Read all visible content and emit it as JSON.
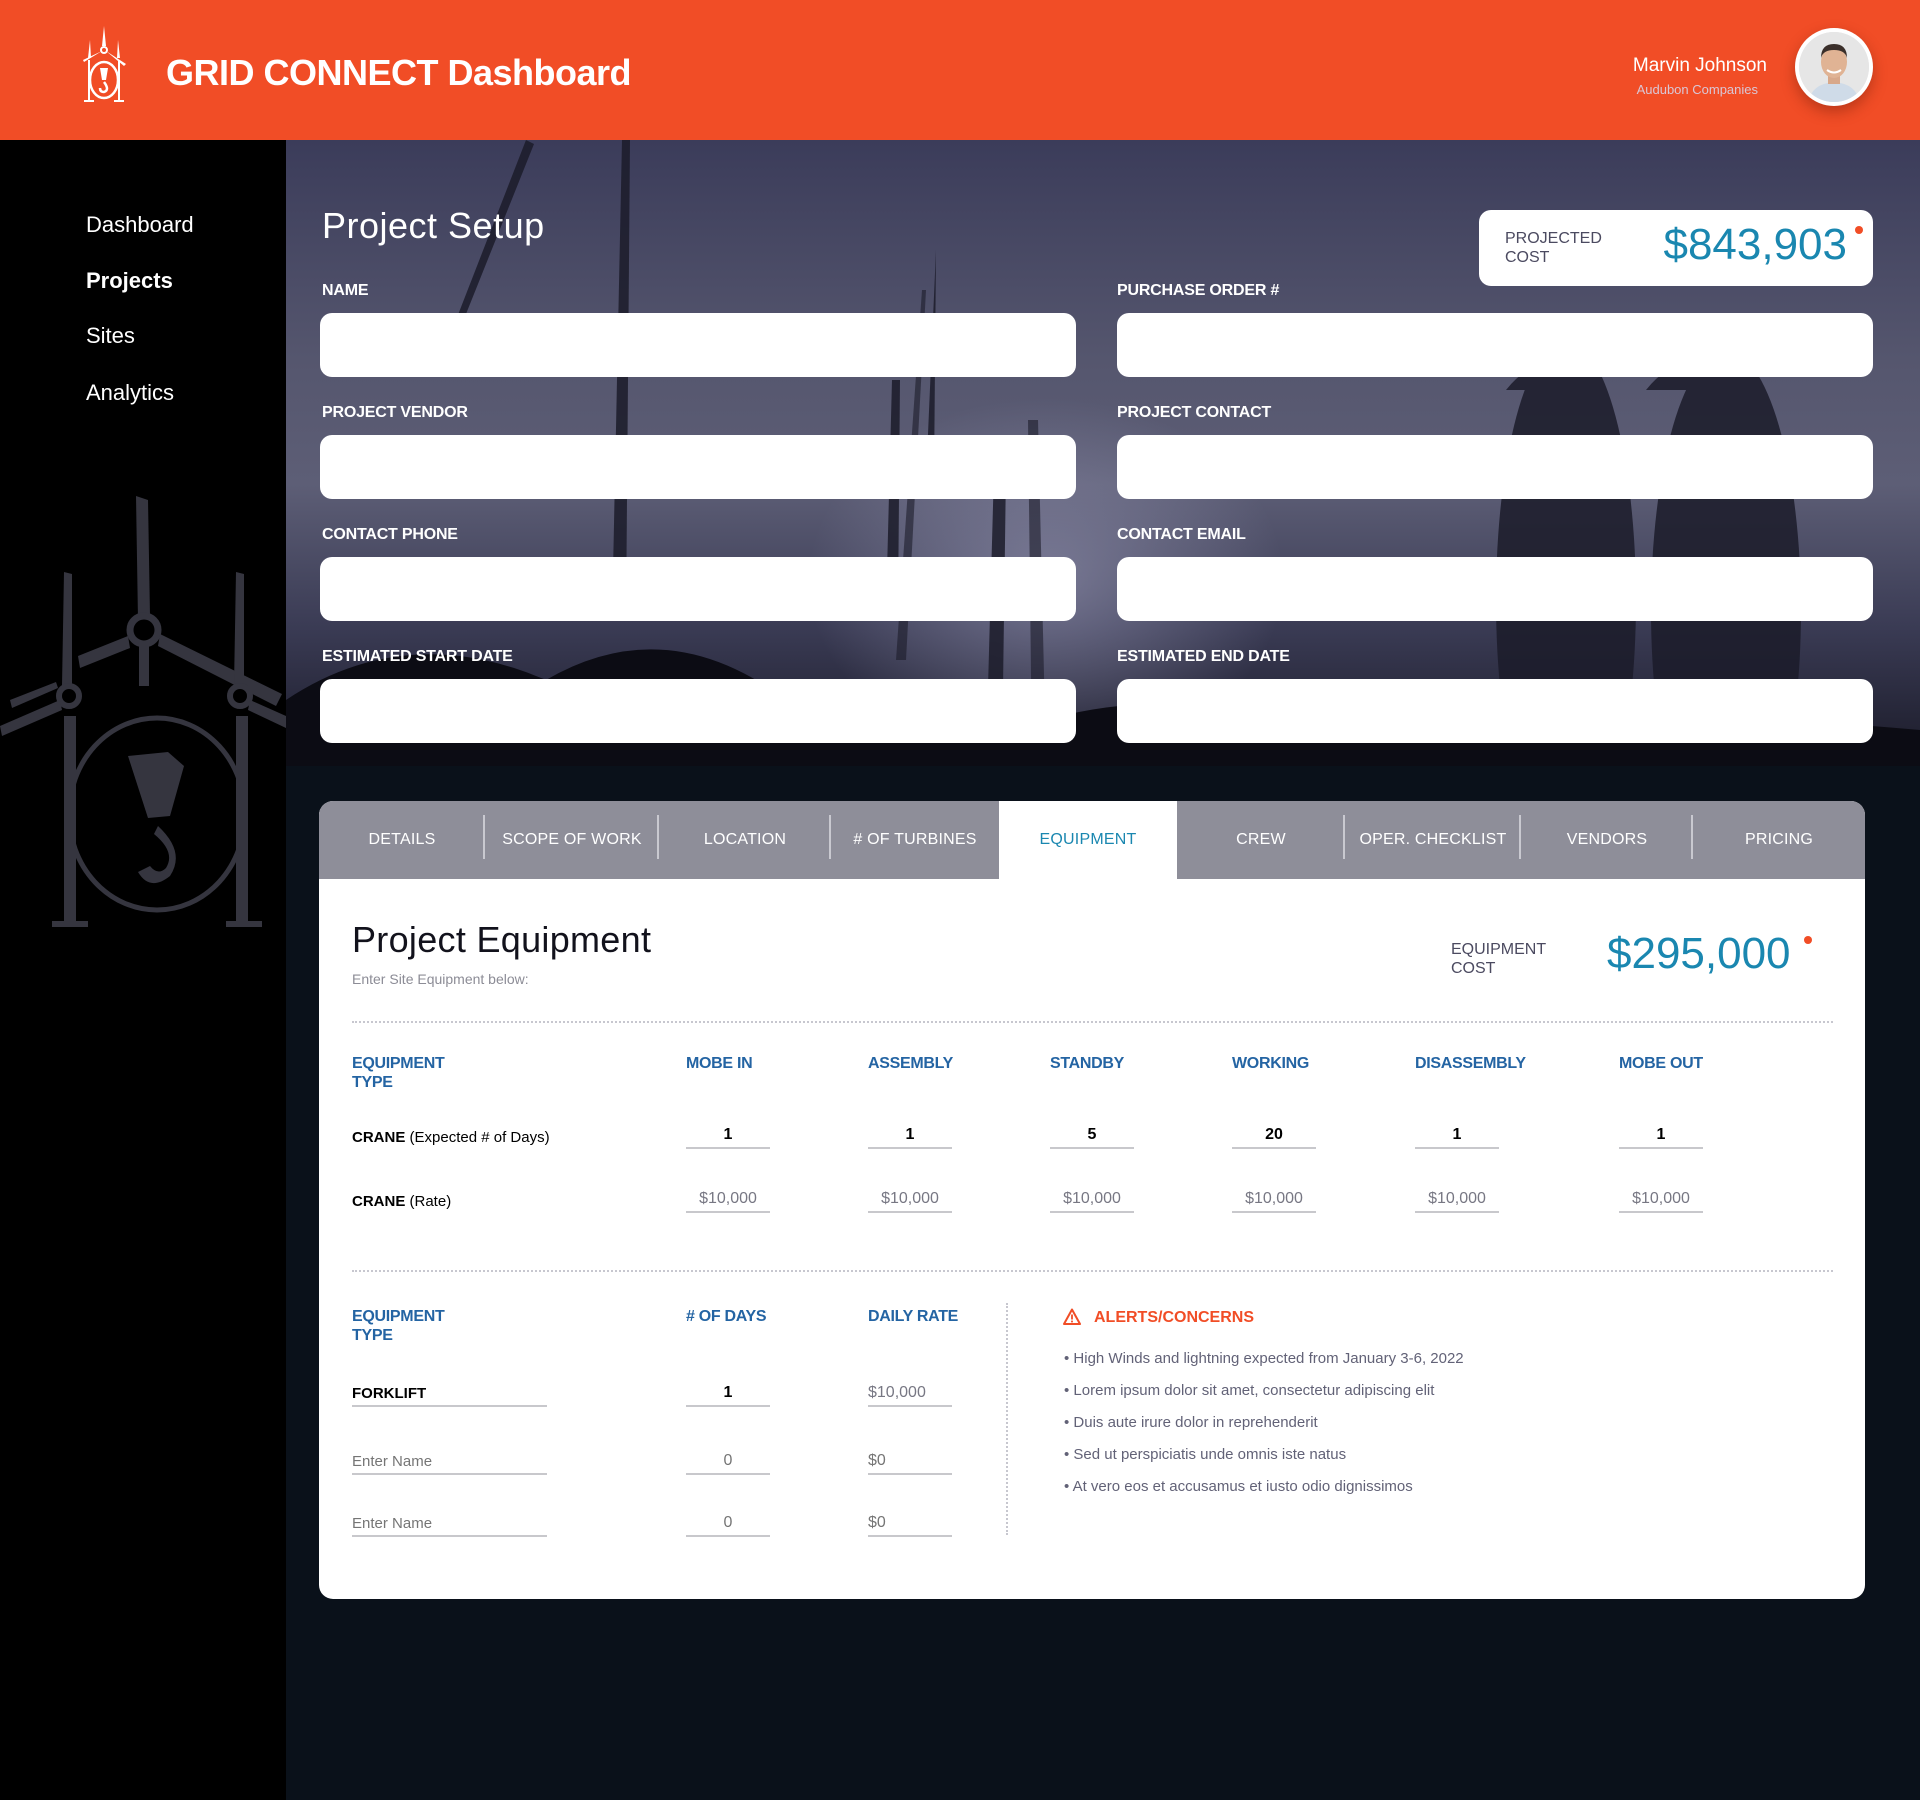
{
  "header": {
    "app_title": "GRID CONNECT Dashboard",
    "logo_icon": "wind-turbine-crane-logo-icon",
    "user": {
      "name": "Marvin Johnson",
      "company": "Audubon Companies",
      "avatar": "user-avatar-photo"
    }
  },
  "sidebar": {
    "items": [
      {
        "label": "Dashboard",
        "active": false
      },
      {
        "label": "Projects",
        "active": true
      },
      {
        "label": "Sites",
        "active": false
      },
      {
        "label": "Analytics",
        "active": false
      }
    ],
    "decoration": "wind-turbine-crane-illustration"
  },
  "project_setup": {
    "title": "Project Setup",
    "projected_cost": {
      "label": "PROJECTED COST",
      "value": "$843,903"
    },
    "fields": [
      {
        "label": "NAME",
        "value": ""
      },
      {
        "label": "PURCHASE ORDER #",
        "value": ""
      },
      {
        "label": "PROJECT VENDOR",
        "value": ""
      },
      {
        "label": "PROJECT CONTACT",
        "value": ""
      },
      {
        "label": "CONTACT PHONE",
        "value": ""
      },
      {
        "label": "CONTACT EMAIL",
        "value": ""
      },
      {
        "label": "ESTIMATED START DATE",
        "value": ""
      },
      {
        "label": "ESTIMATED END DATE",
        "value": ""
      }
    ]
  },
  "tabs": [
    {
      "label": "DETAILS",
      "active": false
    },
    {
      "label": "SCOPE OF WORK",
      "active": false
    },
    {
      "label": "LOCATION",
      "active": false
    },
    {
      "label": "# OF TURBINES",
      "active": false
    },
    {
      "label": "EQUIPMENT",
      "active": true
    },
    {
      "label": "CREW",
      "active": false
    },
    {
      "label": "OPER. CHECKLIST",
      "active": false
    },
    {
      "label": "VENDORS",
      "active": false
    },
    {
      "label": "PRICING",
      "active": false
    }
  ],
  "equipment": {
    "title": "Project Equipment",
    "subtitle": "Enter Site Equipment below:",
    "cost": {
      "label": "EQUIPMENT COST",
      "value": "$295,000"
    },
    "crane_table": {
      "type_header": "EQUIPMENT TYPE",
      "columns": [
        "MOBE IN",
        "ASSEMBLY",
        "STANDBY",
        "WORKING",
        "DISASSEMBLY",
        "MOBE OUT"
      ],
      "days_row": {
        "name": "CRANE",
        "suffix": "(Expected # of Days)",
        "values": [
          "1",
          "1",
          "5",
          "20",
          "1",
          "1"
        ]
      },
      "rate_row": {
        "name": "CRANE",
        "suffix": "(Rate)",
        "values": [
          "$10,000",
          "$10,000",
          "$10,000",
          "$10,000",
          "$10,000",
          "$10,000"
        ]
      }
    },
    "other_table": {
      "headers": {
        "type": "EQUIPMENT TYPE",
        "days": "# OF DAYS",
        "rate": "DAILY RATE"
      },
      "rows": [
        {
          "name": "FORKLIFT",
          "name_placeholder": "Enter Name",
          "days": "1",
          "days_placeholder": "0",
          "rate": "$10,000",
          "rate_placeholder": "$0"
        },
        {
          "name": "",
          "name_placeholder": "Enter Name",
          "days": "",
          "days_placeholder": "0",
          "rate": "",
          "rate_placeholder": "$0"
        },
        {
          "name": "",
          "name_placeholder": "Enter Name",
          "days": "",
          "days_placeholder": "0",
          "rate": "",
          "rate_placeholder": "$0"
        }
      ]
    },
    "alerts": {
      "title": "ALERTS/CONCERNS",
      "icon": "warning-triangle-icon",
      "items": [
        "• High Winds and lightning expected from January 3-6, 2022",
        "• Lorem ipsum dolor sit amet, consectetur adipiscing elit",
        "• Duis aute irure dolor in reprehenderit",
        "• Sed ut perspiciatis unde omnis iste natus",
        "• At vero eos et accusamus et iusto odio dignissimos"
      ]
    }
  },
  "colors": {
    "brand": "#f14d26",
    "accent": "#1a87b0",
    "header_text": "#2464a3",
    "tab_bg": "#8e8e99"
  }
}
